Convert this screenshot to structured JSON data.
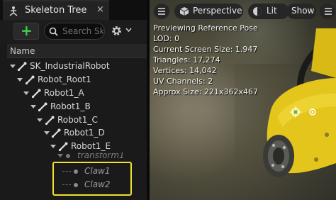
{
  "panel": {
    "tab_title": "Skeleton Tree",
    "tab_close": "×",
    "search_placeholder": "Search Sk",
    "add_label": "+",
    "column_header": "Name"
  },
  "tree": {
    "nodes": [
      {
        "label": "SK_IndustrialRobot"
      },
      {
        "label": "Robot_Root1"
      },
      {
        "label": "Robot1_A"
      },
      {
        "label": "Robot1_B"
      },
      {
        "label": "Robot1_C"
      },
      {
        "label": "Robot1_D"
      },
      {
        "label": "Robot1_E"
      },
      {
        "label": "transform1"
      },
      {
        "label": "Claw1"
      },
      {
        "label": "Claw2"
      }
    ]
  },
  "viewport": {
    "perspective_label": "Perspective",
    "lit_label": "Lit",
    "show_label": "Show",
    "stats": [
      "Previewing Reference Pose",
      "LOD: 0",
      "Current Screen Size: 1.947",
      "Triangles: 17,274",
      "Vertices: 14,042",
      "UV Channels: 2",
      "Approx Size: 221x362x467"
    ]
  },
  "colors": {
    "accent_green": "#3fd24a",
    "highlight_yellow": "#f1e12a",
    "robot_yellow": "#e3c51c"
  }
}
